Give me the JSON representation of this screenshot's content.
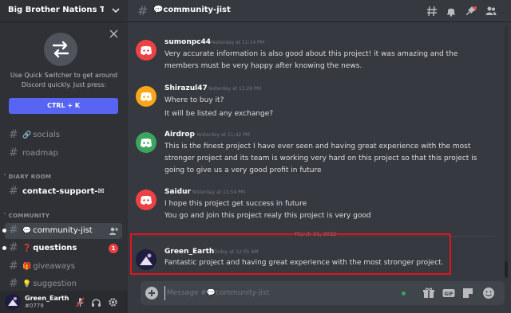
{
  "server": {
    "name": "Big Brother Nations Tok..."
  },
  "quick_switcher": {
    "text": "Use Quick Switcher to get around Discord quickly. Just press:",
    "shortcut_label": "CTRL + K"
  },
  "channels": [
    {
      "label": "socials",
      "emoji": "🔗"
    },
    {
      "label": "roadmap",
      "emoji": ""
    }
  ],
  "categories": {
    "diary_room": "DIARY ROOM",
    "community": "COMMUNITY"
  },
  "diary_channels": [
    {
      "label": "contact-support-",
      "emoji_after": "✉"
    }
  ],
  "community_channels": [
    {
      "label": "community-jist",
      "emoji": "💬"
    },
    {
      "label": "questions",
      "emoji": "❓",
      "badge": "1"
    },
    {
      "label": "giveaways",
      "emoji": "🎁"
    },
    {
      "label": "suggestion",
      "emoji": "💡"
    }
  ],
  "user": {
    "name": "Green_Earth",
    "tag": "#0779"
  },
  "header": {
    "channel_title": "community-jist",
    "channel_emoji": "💬"
  },
  "messages": [
    {
      "author": "sumonpc44",
      "time": "Yesterday at 11:14 PM",
      "lines": [
        "Very accurate information is also good about this project! it was amazing and the",
        "members must be very happy after knowing the news."
      ],
      "avatar_color": "#ed4245"
    },
    {
      "author": "Shirazul47",
      "time": "Yesterday at 11:26 PM",
      "lines": [
        "Where to buy it?",
        "It will be listed any exchange?"
      ],
      "avatar_color": "#faa61a"
    },
    {
      "author": "Airdrop",
      "time": "Yesterday at 11:42 PM",
      "lines": [
        "This is the finest project I have ever seen and having great experience with the most",
        "stronger project and its team is working very hard on this project so that this project is",
        "going to give us a very good profit in future"
      ],
      "avatar_color": "#3ba55d"
    },
    {
      "author": "Saidur",
      "time": "Yesterday at 11:54 PM",
      "lines": [
        "I hope this project get success in future",
        "You go and join this project realy this project is very good"
      ],
      "avatar_color": "#ed4245"
    },
    {
      "author": "Green_Earth",
      "time": "Today at 12:05 AM",
      "lines": [
        "Fantastic project and having great experience with the most stronger project."
      ],
      "avatar_color": "#1f1d3d"
    }
  ],
  "date_divider": "March 31, 2022",
  "composer": {
    "placeholder": "Message #💬community-jist"
  },
  "colors": {
    "accent": "#5865f2",
    "highlight_border": "#e0141e",
    "badge": "#ed4245",
    "online": "#3ba55d"
  }
}
